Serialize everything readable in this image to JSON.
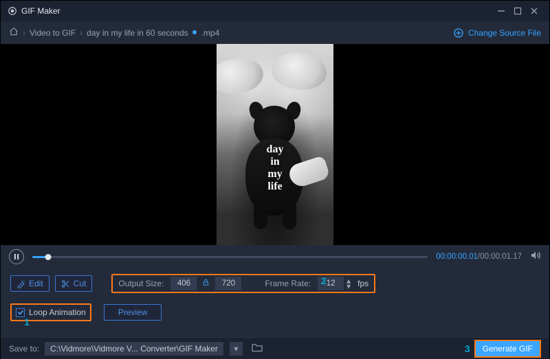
{
  "window": {
    "title": "GIF Maker"
  },
  "breadcrumb": {
    "root_label": "Video to GIF",
    "file_label_prefix": "day in my life in 60 seconds",
    "file_label_suffix": ".mp4",
    "change_source_label": "Change Source File"
  },
  "video_overlay": {
    "l1": "day",
    "l2": "in",
    "l3": "my",
    "l4": "life"
  },
  "playback": {
    "current_time": "00:00:00.01",
    "duration": "00:00:01.17",
    "progress_sep": "/"
  },
  "edit_button_label": "Edit",
  "cut_button_label": "Cut",
  "output": {
    "size_label": "Output Size:",
    "width": "406",
    "height": "720",
    "framerate_label": "Frame Rate:",
    "framerate_value": "12",
    "fps_suffix": "fps"
  },
  "loop_label": "Loop Animation",
  "preview_label": "Preview",
  "steps": {
    "one": "1",
    "two": "2",
    "three": "3"
  },
  "save": {
    "label": "Save to:",
    "path": "C:\\Vidmore\\Vidmore V... Converter\\GIF Maker"
  },
  "generate_label": "Generate GIF"
}
